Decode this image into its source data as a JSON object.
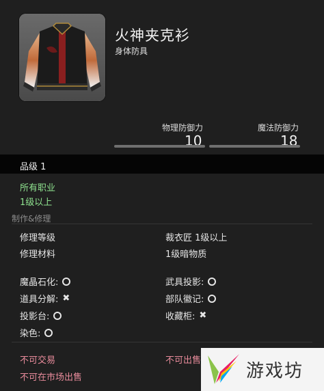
{
  "item": {
    "name": "火神夹克衫",
    "type": "身体防具",
    "icon": "jacket-icon"
  },
  "stats": {
    "physical_label": "物理防御力",
    "physical_value": "10",
    "magic_label": "魔法防御力",
    "magic_value": "18"
  },
  "grade": "品级 1",
  "requirements": {
    "jobs": "所有职业",
    "level": "1级以上"
  },
  "craft": {
    "section_title": "制作&修理",
    "repair_level_label": "修理等级",
    "repair_level_value": "裁衣匠 1级以上",
    "repair_material_label": "修理材料",
    "repair_material_value": "1级暗物质"
  },
  "properties": [
    {
      "label": "魔晶石化:",
      "value": "circle"
    },
    {
      "label": "武具投影:",
      "value": "circle"
    },
    {
      "label": "道具分解:",
      "value": "cross"
    },
    {
      "label": "部队徽记:",
      "value": "circle"
    },
    {
      "label": "投影台:",
      "value": "circle"
    },
    {
      "label": "收藏柜:",
      "value": "cross"
    },
    {
      "label": "染色:",
      "value": "circle"
    }
  ],
  "restrictions": {
    "untradable": "不可交易",
    "unsellable": "不可出售",
    "no_market": "不可在市场出售"
  },
  "watermark": {
    "text": "游戏坊"
  },
  "colors": {
    "background": "#1f1f1f",
    "green": "#8fe28f",
    "pink": "#e88b9b"
  }
}
